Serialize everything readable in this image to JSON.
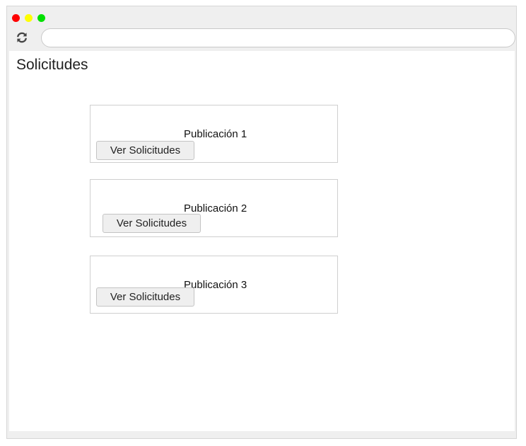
{
  "toolbar": {
    "address_value": "",
    "reload_icon": "refresh-icon"
  },
  "page": {
    "title": "Solicitudes"
  },
  "cards": [
    {
      "title": "Publicación 1",
      "button_label": "Ver Solicitudes"
    },
    {
      "title": "Publicación 2",
      "button_label": "Ver Solicitudes"
    },
    {
      "title": "Publicación 3",
      "button_label": "Ver Solicitudes"
    }
  ],
  "colors": {
    "close": "#fe0000",
    "minimize": "#fefe00",
    "maximize": "#00e000"
  }
}
